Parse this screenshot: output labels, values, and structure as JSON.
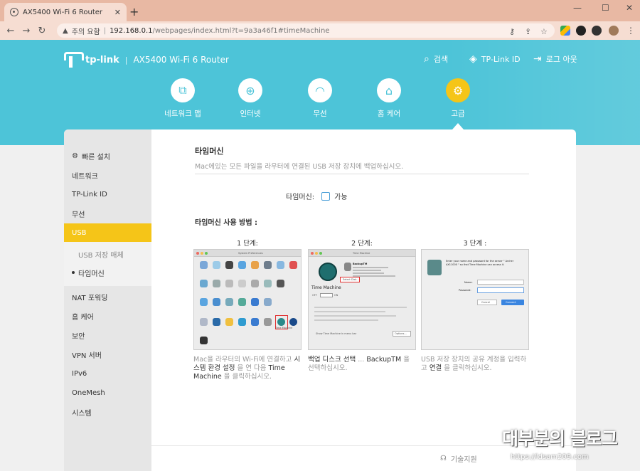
{
  "browser": {
    "tab_title": "AX5400 Wi-Fi 6 Router",
    "security_label": "주의 요함",
    "url_host": "192.168.0.1",
    "url_path": "/webpages/index.html?t=9a3a46f1#timeMachine",
    "controls": {
      "minimize": "—",
      "maximize": "☐",
      "close": "✕"
    }
  },
  "header": {
    "brand": "tp-link",
    "model": "AX5400 Wi-Fi 6 Router",
    "search": "검색",
    "tplink_id": "TP-Link ID",
    "logout": "로그 아웃"
  },
  "main_nav": [
    {
      "label": "네트워크 맵",
      "icon": "network-map-icon"
    },
    {
      "label": "인터넷",
      "icon": "globe-icon"
    },
    {
      "label": "무선",
      "icon": "wifi-icon"
    },
    {
      "label": "홈 케어",
      "icon": "home-care-icon"
    },
    {
      "label": "고급",
      "icon": "gear-icon",
      "active": true
    }
  ],
  "sidebar": {
    "items": [
      {
        "label": "빠른 설치"
      },
      {
        "label": "네트워크"
      },
      {
        "label": "TP-Link ID"
      },
      {
        "label": "무선"
      },
      {
        "label": "USB",
        "active": true
      },
      {
        "label": "USB 저장 매체"
      },
      {
        "label": "타임머신",
        "current": true
      },
      {
        "label": "NAT 포워딩"
      },
      {
        "label": "홈 케어"
      },
      {
        "label": "보안"
      },
      {
        "label": "VPN 서버"
      },
      {
        "label": "IPv6"
      },
      {
        "label": "OneMesh"
      },
      {
        "label": "시스템"
      }
    ]
  },
  "content": {
    "title": "타임머신",
    "description": "Mac에있는 모든 파일을 라우터에 연결된 USB 저장 장치에 백업하십시오.",
    "tm_label": "타임머신:",
    "tm_checkbox_label": "가능",
    "howto": "타임머신 사용 방법 :",
    "steps": [
      {
        "label": "1 단계:",
        "text_pre": "Mac을 라우터의 Wi-Fi에 연결하고 ",
        "text_em1": "시스템 환경 설정",
        "text_mid": " 을 연 다음 ",
        "text_em2": "Time Machine",
        "text_post": " 을 클릭하십시오."
      },
      {
        "label": "2 단계:",
        "text_pre": "",
        "text_em1": "백업 디스크 선택",
        "text_mid": " ... ",
        "text_em2": "BackupTM",
        "text_post": " 을 선택하십시오."
      },
      {
        "label": "3 단계 :",
        "text_pre": "USB 저장 장치의 공유 계정을 입력하고 ",
        "text_em1": "연결",
        "text_mid": "",
        "text_em2": "",
        "text_post": " 을 클릭하십시오."
      }
    ],
    "shot1": {
      "window_title": "System Preferences",
      "tm_label": "Time Machine"
    },
    "shot2": {
      "window_title": "Time Machine",
      "brand": "Time Machine",
      "off": "OFF",
      "on": "ON",
      "backup_name": "BackupTM",
      "select_disk": "Select Disk...",
      "show_menu": "Show Time Machine in menu bar",
      "options": "Options..."
    },
    "shot3": {
      "prompt": "Enter your name and password for the server \" Archer AX11000 \" so that Time Machine can access it.",
      "name_label": "Name:",
      "password_label": "Password:",
      "cancel": "Cancel",
      "connect": "Connect"
    }
  },
  "footer": {
    "support": "기술지원"
  },
  "watermark": {
    "title": "대부분의 블로그",
    "url": "https://ldsam209.com"
  },
  "colors": {
    "accent": "#4dc4d8",
    "active": "#f5c518"
  }
}
